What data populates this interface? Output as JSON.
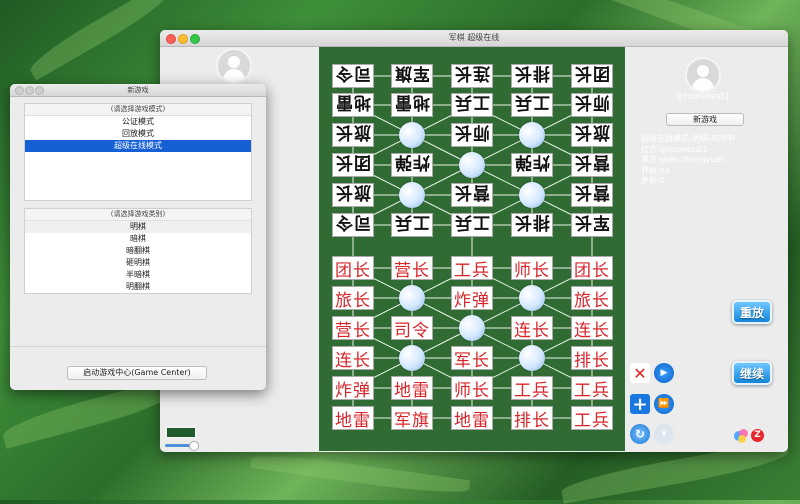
{
  "main_window": {
    "title": "军棋 超级在线",
    "left_avatar_caption": "",
    "right_player_name": "iphonetest1",
    "new_game_button": "新游戏",
    "info_lines": [
      "超级在线模式-明棋-布阵中",
      "红方:iphonetest1",
      "黑方:shen zhongyuan",
      "开始:na",
      "步数:0"
    ],
    "redo_button": "重放",
    "continue_button": "继续"
  },
  "controls": {
    "close_icon_glyph": "✕",
    "play_icon_glyph": "▶",
    "plus_icon_glyph": "+",
    "fast_forward_icon_glyph": "⏩",
    "refresh_icon_glyph": "↻",
    "pause_icon_glyph": "⏸"
  },
  "board": {
    "black_rows": [
      [
        "司令",
        "军旗",
        "连长",
        "排长",
        "团长"
      ],
      [
        "地雷",
        "地雷",
        "工兵",
        "工兵",
        "师长"
      ],
      [
        "旅长",
        "",
        "师长",
        "",
        "旅长"
      ],
      [
        "团长",
        "炸弹",
        "",
        "炸弹",
        "营长"
      ],
      [
        "旅长",
        "",
        "营长",
        "",
        "营长"
      ],
      [
        "司令",
        "工兵",
        "工兵",
        "排长",
        "军长"
      ]
    ],
    "red_rows": [
      [
        "团长",
        "营长",
        "工兵",
        "师长",
        "团长"
      ],
      [
        "旅长",
        "",
        "炸弹",
        "",
        "旅长"
      ],
      [
        "营长",
        "司令",
        "",
        "连长",
        "连长"
      ],
      [
        "连长",
        "",
        "军长",
        "",
        "排长"
      ],
      [
        "炸弹",
        "地雷",
        "师长",
        "工兵",
        "工兵"
      ],
      [
        "地雷",
        "军旗",
        "地雷",
        "排长",
        "工兵"
      ]
    ]
  },
  "left_window": {
    "title": "新游戏",
    "mode_header": "(请选择游戏模式)",
    "modes": [
      "公证模式",
      "回放模式",
      "超级在线模式"
    ],
    "selected_mode": 2,
    "type_header": "(请选择游戏类别)",
    "types": [
      "明棋",
      "暗棋",
      "暗翻棋",
      "砸明棋",
      "半暗棋",
      "明翻棋"
    ],
    "game_center_button": "启动游戏中心(Game Center)"
  },
  "colors": {
    "board_green": "#2f6b33",
    "red_piece": "#d8252b",
    "selection_blue": "#1560d4",
    "side_button_blue": "#1486d8"
  }
}
